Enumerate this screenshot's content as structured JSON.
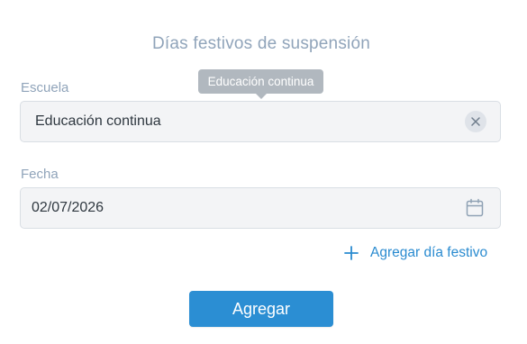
{
  "title": "Días festivos de suspensión",
  "tooltip": "Educación continua",
  "escuela": {
    "label": "Escuela",
    "value": "Educación continua",
    "clear_icon": "close-icon"
  },
  "fecha": {
    "label": "Fecha",
    "value": "02/07/2026",
    "calendar_icon": "calendar-icon"
  },
  "add_holiday": {
    "icon": "plus-icon",
    "label": "Agregar día festivo"
  },
  "submit": {
    "label": "Agregar"
  },
  "colors": {
    "accent": "#2b8ed3",
    "link": "#2a8bd0",
    "muted_text": "#90a4ba",
    "field_bg": "#f3f4f6",
    "tooltip_bg": "#b1b8bf"
  }
}
